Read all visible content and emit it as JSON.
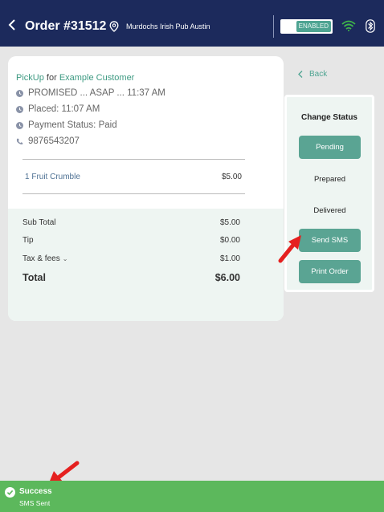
{
  "header": {
    "order_title": "Order #31512",
    "location": "Murdochs Irish Pub Austin",
    "toggle_label": "ENABLED"
  },
  "order": {
    "pickup": "PickUp",
    "for_word": "for",
    "customer": "Example Customer",
    "promised": "PROMISED ... ASAP ... 11:37 AM",
    "placed": "Placed: 11:07 AM",
    "payment": "Payment Status: Paid",
    "phone": "9876543207",
    "items": [
      {
        "name": "1 Fruit Crumble",
        "price": "$5.00"
      }
    ],
    "totals": {
      "subtotal_label": "Sub Total",
      "subtotal": "$5.00",
      "tip_label": "Tip",
      "tip": "$0.00",
      "tax_label": "Tax & fees",
      "tax": "$1.00",
      "total_label": "Total",
      "total": "$6.00"
    }
  },
  "status_panel": {
    "back": "Back",
    "title": "Change Status",
    "pending": "Pending",
    "prepared": "Prepared",
    "delivered": "Delivered",
    "send_sms": "Send SMS",
    "print_order": "Print Order"
  },
  "toast": {
    "title": "Success",
    "message": "SMS Sent"
  },
  "colors": {
    "header_bg": "#1c2a5c",
    "accent_green": "#5aa493",
    "toast_green": "#5cb85c",
    "annotation_red": "#e5201f"
  }
}
